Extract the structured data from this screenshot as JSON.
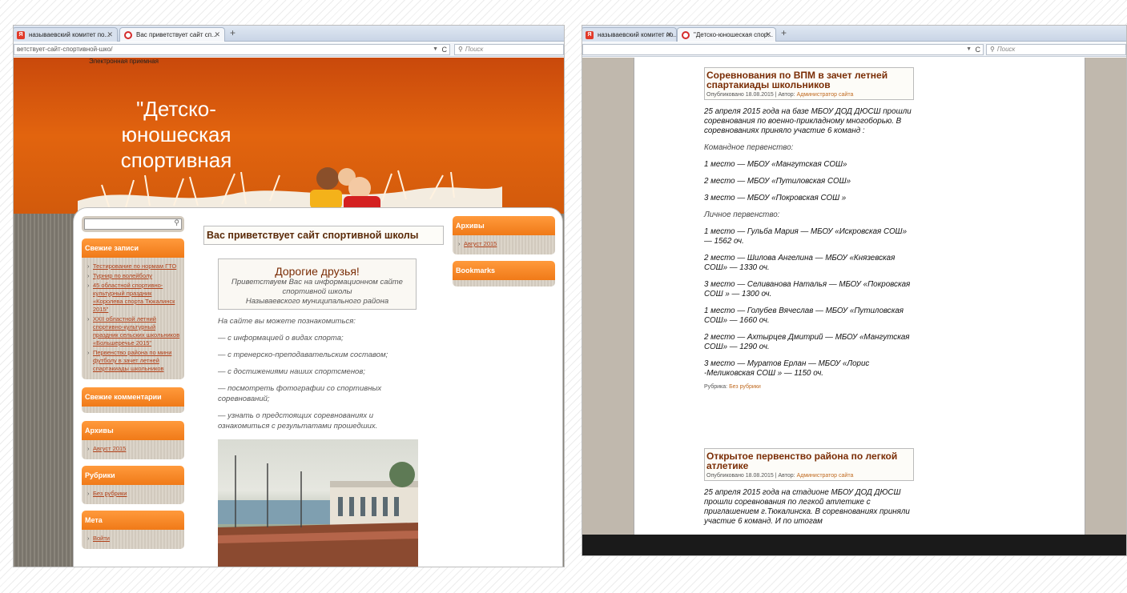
{
  "left_window": {
    "tabs": [
      {
        "title": "называевский комитет по..."
      },
      {
        "title": "Вас приветствует сайт сп..."
      }
    ],
    "url": "ветствует-сайт-спортивной-шко/",
    "search_placeholder": "Поиск",
    "header": {
      "top_link": "Электронная приемная",
      "site_title": "\"Детско-юношеская спортивная"
    },
    "page_title": "Вас приветствует сайт спортивной школы",
    "welcome": {
      "heading": "Дорогие друзья!",
      "line1": "Приветствуем Вас на информационном сайте",
      "line2": "спортивной школы",
      "line3": "Называевского муниципального района"
    },
    "intro": [
      "На сайте вы можете познакомиться:",
      "— с информацией о видах спорта;",
      "— с тренерско-преподавательским составом;",
      "— с достижениями наших спортсменов;",
      "— посмотреть фотографии со спортивных соревнований;",
      "— узнать о предстоящих соревнованиях и ознакомиться с результатами прошедших."
    ],
    "left_sidebar": {
      "recent_posts_title": "Свежие записи",
      "recent_posts": [
        "Тестирование по нормам ГТО",
        "Турнир по волейболу",
        "45 областной спортивно-культурный праздник «Королева спорта Тюкалинск 2015\"",
        "XXII областной летний спортивно-культурный праздник сельских школьников «Большеречье 2015\"",
        "Первенство района по мини футболу в зачет летней спартакиады школьников"
      ],
      "recent_comments_title": "Свежие комментарии",
      "archives_title": "Архивы",
      "archives": [
        "Август 2015"
      ],
      "categories_title": "Рубрики",
      "categories": [
        "Без рубрики"
      ],
      "meta_title": "Мета",
      "meta": [
        "Войти"
      ]
    },
    "right_sidebar": {
      "archives_title": "Архивы",
      "archives": [
        "Август 2015"
      ],
      "bookmarks_title": "Bookmarks"
    }
  },
  "right_window": {
    "tabs": [
      {
        "title": "называевский комитет по..."
      },
      {
        "title": "\"Детско-юношеская спор..."
      }
    ],
    "search_placeholder": "Поиск",
    "post1": {
      "title": "Соревнования по ВПМ в зачет летней спартакиады школьников",
      "meta_prefix": "Опубликовано 18.08.2015 | Автор:",
      "author": "Администратор сайта",
      "paragraphs": [
        "25 апреля 2015 года на базе МБОУ ДОД ДЮСШ прошли соревнования по военно-прикладному многоборью. В соревнованиях приняло участие 6 команд :",
        "Командное первенство:",
        "1 место — МБОУ «Мангутская СОШ»",
        "2 место — МБОУ «Путиловская СОШ»",
        "3 место — МБОУ «Покровская СОШ »",
        "Личное первенство:",
        "1 место — Гульба Мария — МБОУ «Искровская СОШ» — 1562 оч.",
        "2 место — Шилова Ангелина — МБОУ «Князевская СОШ» — 1330 оч.",
        "3 место — Селиванова Наталья — МБОУ «Покровская СОШ » — 1300 оч.",
        "1 место — Голубев Вячеслав — МБОУ «Путиловская СОШ» — 1660 оч.",
        "2 место — Ахтырцев Дмитрий  — МБОУ «Мангутская СОШ» — 1290 оч.",
        "3 место — Муратов Ерлан — МБОУ «Лорис -Меликовская СОШ » — 1150 оч."
      ],
      "rubric_prefix": "Рубрика:",
      "rubric": "Без рубрики"
    },
    "post2": {
      "title": "Открытое первенство района по легкой атлетике",
      "meta_prefix": "Опубликовано 18.08.2015 | Автор:",
      "author": "Администратор сайта",
      "paragraph": "25 апреля 2015 года на стадионе МБОУ ДОД ДЮСШ прошли соревнования по легкой атлетике с приглашением г.Тюкалинска. В соревнованиях приняли участие 6 команд. И по итогам"
    }
  }
}
